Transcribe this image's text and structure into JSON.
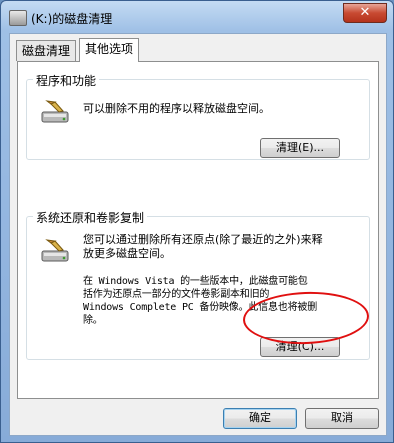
{
  "window": {
    "title": "(K:)的磁盘清理",
    "close_label": "✕"
  },
  "tabs": [
    {
      "label": "磁盘清理",
      "active": false
    },
    {
      "label": "其他选项",
      "active": true
    }
  ],
  "programs": {
    "label": "程序和功能",
    "description": "可以删除不用的程序以释放磁盘空间。",
    "button_label": "清理(E)..."
  },
  "restore": {
    "label": "系统还原和卷影复制",
    "description": [
      "您可以通过删除所有还原点(除了最近的之外)来释",
      "放更多磁盘空间。"
    ],
    "note": [
      "在 Windows Vista 的一些版本中，此磁盘可能包",
      "括作为还原点一部分的文件卷影副本和旧的",
      "Windows Complete PC 备份映像。此信息也将被删",
      "除。"
    ],
    "button_label": "清理(C)..."
  },
  "footer": {
    "ok_label": "确定",
    "cancel_label": "取消"
  },
  "colors": {
    "annotation": "#e01010",
    "titlebar": "#9fc0e6"
  },
  "icons": {
    "window": "drive-cleanup-icon",
    "programs": "drive-broom-icon",
    "restore": "drive-broom-icon"
  }
}
